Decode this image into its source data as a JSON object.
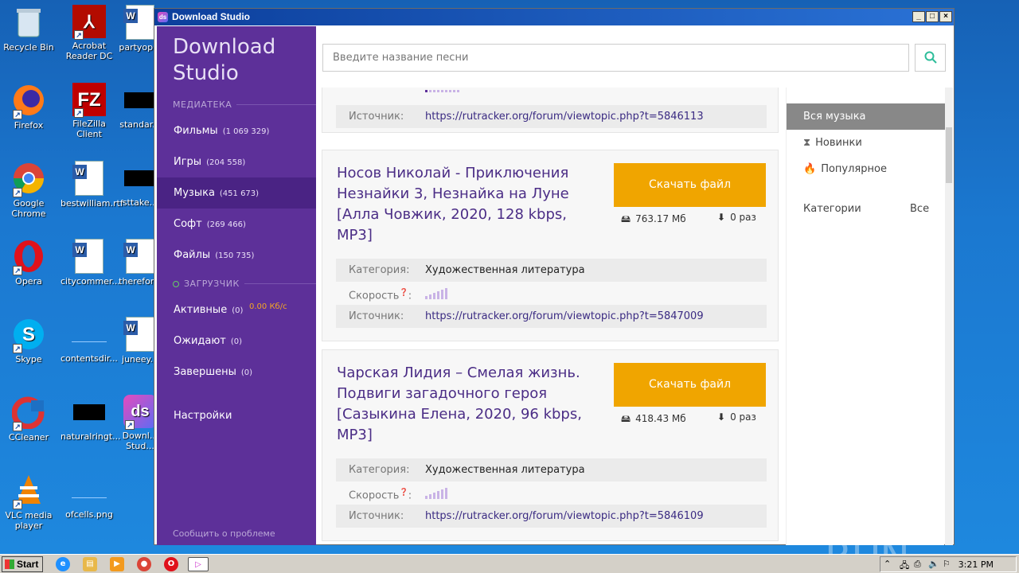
{
  "desktop": {
    "icons": [
      {
        "label": "Recycle Bin"
      },
      {
        "label": "Acrobat Reader DC"
      },
      {
        "label": "partyop..."
      },
      {
        "label": "Firefox"
      },
      {
        "label": "FileZilla Client"
      },
      {
        "label": "standar..."
      },
      {
        "label": "Google Chrome"
      },
      {
        "label": "bestwilliam.rtf"
      },
      {
        "label": "sttake..."
      },
      {
        "label": "Opera"
      },
      {
        "label": "citycommer..."
      },
      {
        "label": "therefor..."
      },
      {
        "label": "Skype"
      },
      {
        "label": "contentsdir..."
      },
      {
        "label": "juneey..."
      },
      {
        "label": "CCleaner"
      },
      {
        "label": "naturalringt..."
      },
      {
        "label": "Downl... Stud..."
      },
      {
        "label": "VLC media player"
      },
      {
        "label": "ofcells.png"
      }
    ],
    "watermark": "ANY ▷ RUN"
  },
  "window": {
    "title": "Download Studio"
  },
  "sidebar": {
    "brand": "Download Studio",
    "library_head": "МЕДИАТЕКА",
    "library": [
      {
        "label": "Фильмы",
        "count": "(1 069 329)"
      },
      {
        "label": "Игры",
        "count": "(204 558)"
      },
      {
        "label": "Музыка",
        "count": "(451 673)"
      },
      {
        "label": "Софт",
        "count": "(269 466)"
      },
      {
        "label": "Файлы",
        "count": "(150 735)"
      }
    ],
    "loader_head": "ЗАГРУЗЧИК",
    "loader": [
      {
        "label": "Активные",
        "count": "(0)",
        "speed": "0.00 Кб/с"
      },
      {
        "label": "Ожидают",
        "count": "(0)"
      },
      {
        "label": "Завершены",
        "count": "(0)"
      }
    ],
    "settings": "Настройки",
    "report": "Сообщить о проблеме"
  },
  "search": {
    "placeholder": "Введите название песни",
    "icon": "search-icon"
  },
  "labels": {
    "category": "Категория:",
    "speed": "Скорость",
    "source": "Источник:",
    "download": "Скачать файл"
  },
  "cards": [
    {
      "source": "https://rutracker.org/forum/viewtopic.php?t=5846113"
    },
    {
      "title": "Носов Николай - Приключения Незнайки 3, Незнайка на Луне [Алла Човжик, 2020, 128 kbps, MP3]",
      "size": "763.17 Мб",
      "downloads": "0 раз",
      "category": "Художественная литература",
      "source": "https://rutracker.org/forum/viewtopic.php?t=5847009"
    },
    {
      "title": "Чарская Лидия – Смелая жизнь. Подвиги загадочного героя [Сазыкина Елена, 2020, 96 kbps, MP3]",
      "size": "418.43 Мб",
      "downloads": "0 раз",
      "category": "Художественная литература",
      "source": "https://rutracker.org/forum/viewtopic.php?t=5846109"
    }
  ],
  "filters": {
    "items": [
      {
        "label": "Вся музыка",
        "icon": ""
      },
      {
        "label": "Новинки",
        "icon": "hourglass-icon"
      },
      {
        "label": "Популярное",
        "icon": "flame-icon"
      }
    ],
    "categories_label": "Категории",
    "categories_value": "Все"
  },
  "taskbar": {
    "start": "Start",
    "clock": "3:21 PM"
  },
  "colors": {
    "sidebar": "#5d3099",
    "accent": "#f0a500",
    "title": "#4b2d86"
  }
}
